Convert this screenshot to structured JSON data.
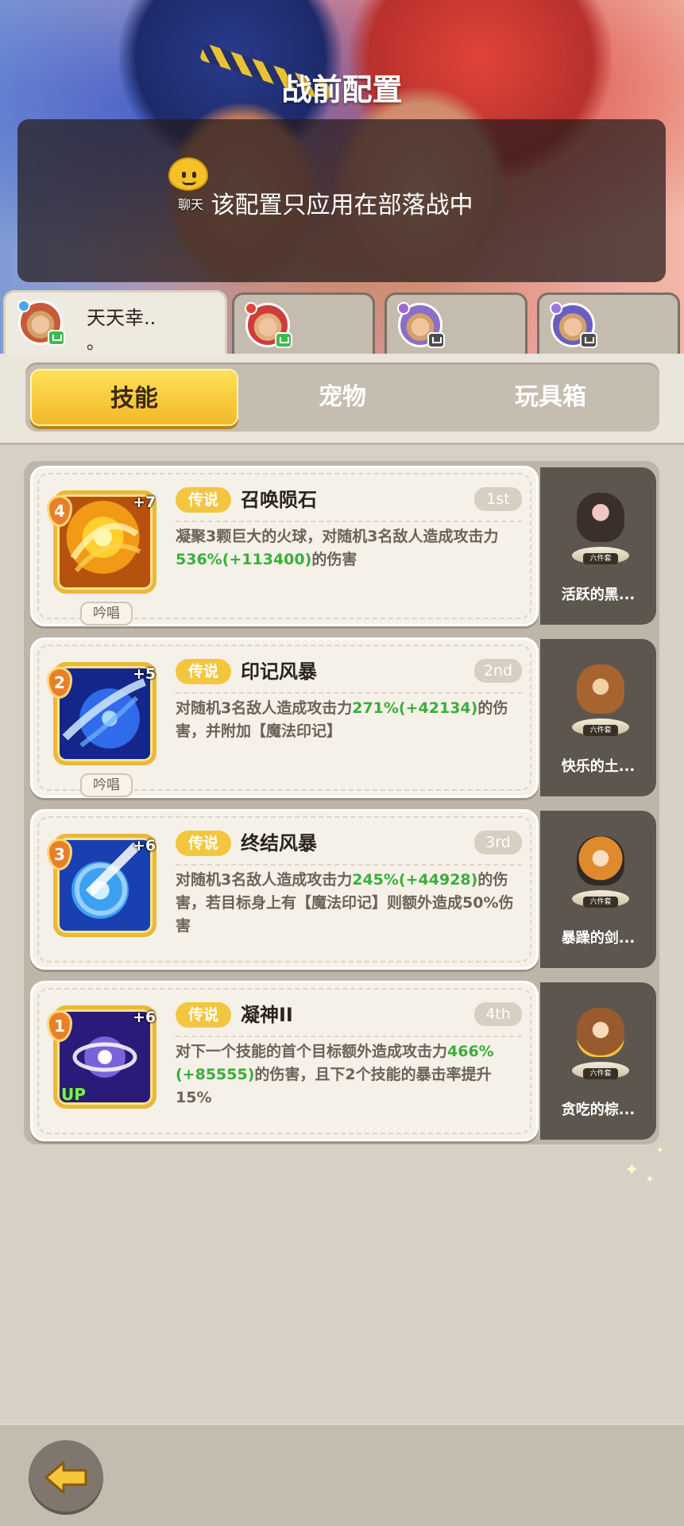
{
  "header": {
    "title": "战前配置",
    "notice": "该配置只应用在部落战中",
    "chat_label": "聊天"
  },
  "players": [
    {
      "name_line1": "天天幸..",
      "name_line2": "。",
      "status": "online",
      "avatar": "avatar-player-1"
    },
    {
      "name_line1": "",
      "name_line2": "",
      "status": "online",
      "avatar": "avatar-player-2"
    },
    {
      "name_line1": "",
      "name_line2": "",
      "status": "offline",
      "avatar": "avatar-player-3"
    },
    {
      "name_line1": "",
      "name_line2": "",
      "status": "offline",
      "avatar": "avatar-player-4"
    }
  ],
  "categories": [
    {
      "label": "技能",
      "active": true
    },
    {
      "label": "宠物",
      "active": false
    },
    {
      "label": "玩具箱",
      "active": false
    }
  ],
  "skills": [
    {
      "level": "4",
      "plus": "+7",
      "cast": "吟唱",
      "up": "",
      "rarity": "传说",
      "name": "召唤陨石",
      "rank": "1st",
      "desc_a": "凝聚3颗巨大的火球，对随机3名敌人造成攻击力",
      "num1": "536%(+113400)",
      "desc_b": "的伤害",
      "icon": "meteor-icon",
      "pet_name": "活跃的黑...",
      "pet_plaque": "六件套"
    },
    {
      "level": "2",
      "plus": "+5",
      "cast": "吟唱",
      "up": "",
      "rarity": "传说",
      "name": "印记风暴",
      "rank": "2nd",
      "desc_a": "对随机3名敌人造成攻击力",
      "num1": "271%(+42134)",
      "desc_b": "的伤害，并附加【魔法印记】",
      "icon": "storm-mark-icon",
      "pet_name": "快乐的土...",
      "pet_plaque": "六件套"
    },
    {
      "level": "3",
      "plus": "+6",
      "cast": "",
      "up": "",
      "rarity": "传说",
      "name": "终结风暴",
      "rank": "3rd",
      "desc_a": "对随机3名敌人造成攻击力",
      "num1": "245%(+44928)",
      "desc_b": "的伤害，若目标身上有【魔法印记】则额外造成50%伤害",
      "icon": "storm-end-icon",
      "pet_name": "暴躁的剑...",
      "pet_plaque": "六件套"
    },
    {
      "level": "1",
      "plus": "+6",
      "cast": "",
      "up": "UP",
      "rarity": "传说",
      "name": "凝神II",
      "rank": "4th",
      "desc_a": "对下一个技能的首个目标额外造成攻击力",
      "num1": "466%(+85555)",
      "desc_b": "的伤害，且下2个技能的暴击率提升15%",
      "icon": "focus-icon",
      "pet_name": "贪吃的棕...",
      "pet_plaque": "六件套"
    }
  ],
  "footer": {
    "back_icon": "back-arrow-icon"
  },
  "colors": {
    "accent_yellow": "#f3c640",
    "highlight_green": "#3aae3a",
    "pet_panel": "#5d564e"
  }
}
